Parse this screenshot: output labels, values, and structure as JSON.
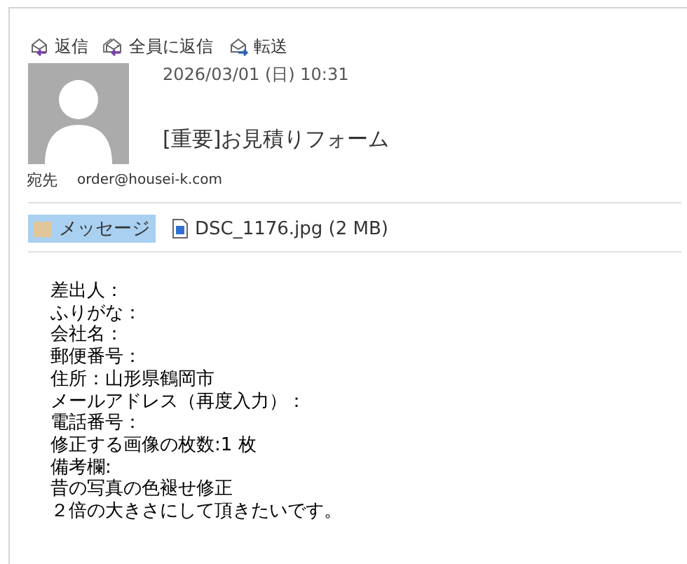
{
  "actions": [
    {
      "kind": "reply",
      "label": "返信"
    },
    {
      "kind": "reply_all",
      "label": "全員に返信"
    },
    {
      "kind": "forward",
      "label": "転送"
    }
  ],
  "header": {
    "date": "2026/03/01 (日) 10:31",
    "subject": "[重要]お見積りフォーム",
    "to_label": "宛先",
    "to": "order@housei-k.com"
  },
  "attachments": [
    {
      "kind": "message",
      "label": "メッセージ",
      "selected": true
    },
    {
      "kind": "file",
      "label": "DSC_1176.jpg (2 MB)",
      "selected": false
    }
  ],
  "body": [
    "差出人：",
    "ふりがな：",
    "会社名：",
    "郵便番号：",
    "住所：山形県鶴岡市",
    "メールアドレス（再度入力）：",
    "電話番号：",
    "修正する画像の枚数:1 枚",
    "備考欄:",
    "昔の写真の色褪せ修正",
    "２倍の大きさにして頂きたいです。"
  ]
}
